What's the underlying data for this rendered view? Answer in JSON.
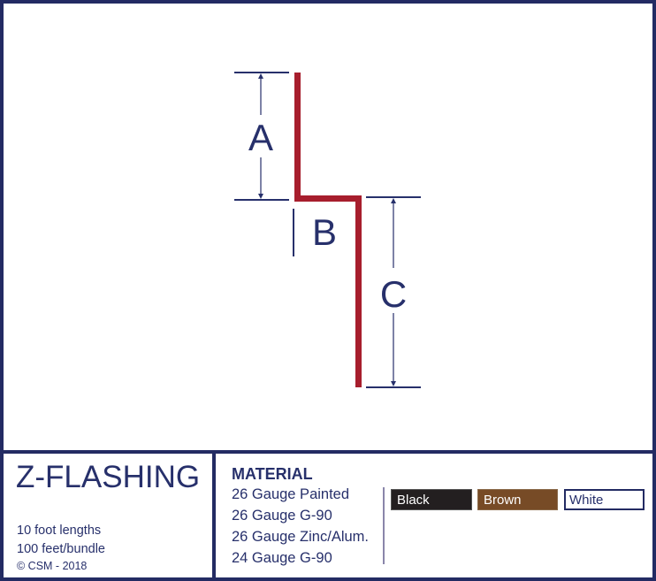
{
  "diagram": {
    "dimension_labels": {
      "a": "A",
      "b": "B",
      "c": "C"
    },
    "colors": {
      "profile": "#a71e2d",
      "dimension_lines": "#27306b",
      "frame": "#232b63"
    }
  },
  "info": {
    "title": "Z-FLASHING",
    "specs": [
      "10 foot lengths",
      "100 feet/bundle"
    ],
    "copyright": "© CSM - 2018"
  },
  "material": {
    "heading": "MATERIAL",
    "items": [
      "26 Gauge Painted",
      "26 Gauge G-90",
      "26 Gauge Zinc/Alum.",
      "24 Gauge G-90"
    ],
    "colors": [
      {
        "label": "Black",
        "hex": "#231f20"
      },
      {
        "label": "Brown",
        "hex": "#774b26"
      },
      {
        "label": "White",
        "hex": "#ffffff"
      }
    ]
  }
}
